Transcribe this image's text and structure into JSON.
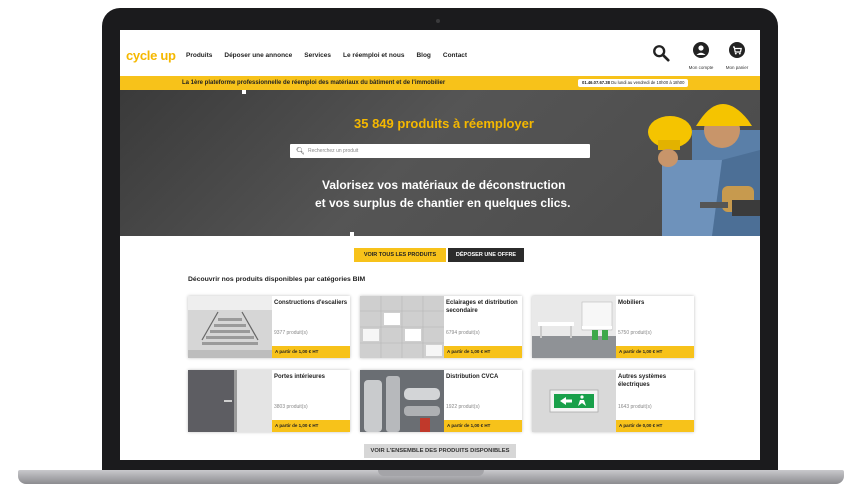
{
  "header": {
    "logo": "cycle up",
    "nav": [
      "Produits",
      "Déposer une annonce",
      "Services",
      "Le réemploi et nous",
      "Blog",
      "Contact"
    ],
    "account_label": "Mon compte",
    "cart_label": "Mon panier"
  },
  "banner": {
    "text": "La 1ère plateforme professionnelle de réemploi des matériaux du bâtiment et de l'immobilier",
    "phone": "01.46.07.67.38",
    "hours": "Du lundi au vendredi de 10h00 à 18h00"
  },
  "hero": {
    "title": "35 849 produits à réemployer",
    "search_placeholder": "Recherchez un produit",
    "slogan_line1": "Valorisez vos matériaux de déconstruction",
    "slogan_line2": "et vos surplus de chantier en quelques clics."
  },
  "actions": {
    "see_all": "VOIR TOUS LES PRODUITS",
    "post_offer": "DÉPOSER UNE OFFRE",
    "see_all_available": "VOIR L'ENSEMBLE DES PRODUITS DISPONIBLES"
  },
  "categories_title": "Découvrir nos produits disponibles par catégories BIM",
  "categories": [
    {
      "name": "Constructions d'escaliers",
      "count": "9377 produit(s)",
      "price": "A partir de 1,00 € HT"
    },
    {
      "name": "Eclairages et distribution secondaire",
      "count": "6794 produit(s)",
      "price": "A partir de 1,00 € HT"
    },
    {
      "name": "Mobiliers",
      "count": "5750 produit(s)",
      "price": "A partir de 1,00 € HT"
    },
    {
      "name": "Portes intérieures",
      "count": "3803 produit(s)",
      "price": "A partir de 1,00 € HT"
    },
    {
      "name": "Distribution CVCA",
      "count": "1922 produit(s)",
      "price": "A partir de 1,00 € HT"
    },
    {
      "name": "Autres systèmes électriques",
      "count": "1643 produit(s)",
      "price": "A partir de 0,00 € HT"
    }
  ],
  "colors": {
    "brand_yellow": "#f7c21a",
    "dark": "#2b2b2b"
  }
}
